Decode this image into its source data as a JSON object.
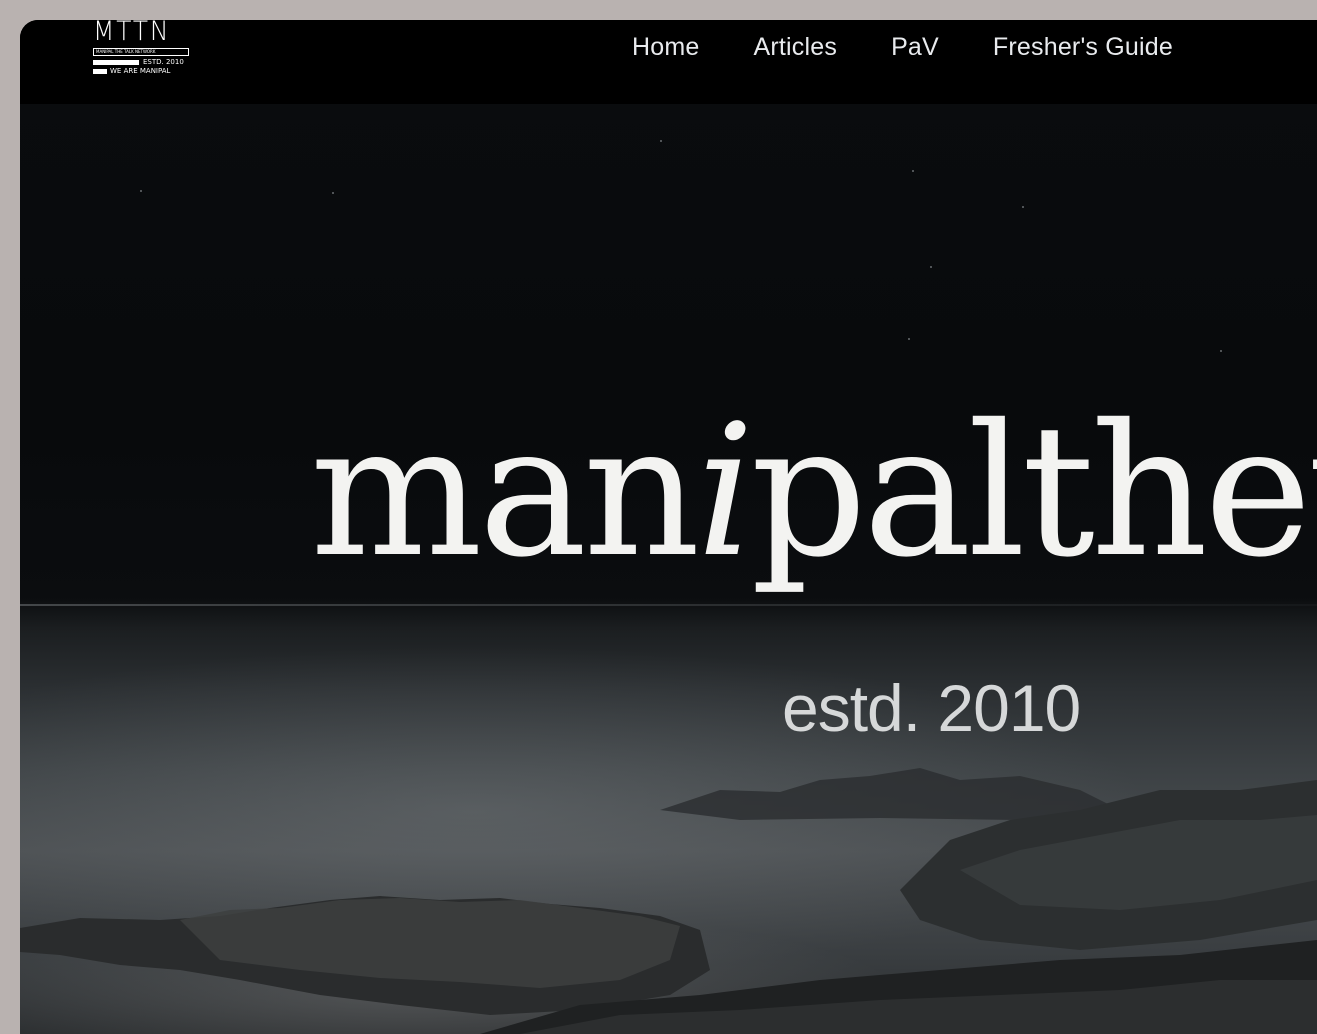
{
  "brand": {
    "logo_mark": "MTTN",
    "logo_line1": "MANIPAL THE TALK NETWORK",
    "logo_line2": "ESTD. 2010",
    "logo_line3": "WE ARE MANIPAL"
  },
  "nav": {
    "items": [
      {
        "label": "Home"
      },
      {
        "label": "Articles"
      },
      {
        "label": "PaV"
      },
      {
        "label": "Fresher's Guide"
      }
    ]
  },
  "hero": {
    "wordmark_pre": "man",
    "wordmark_italic": "i",
    "wordmark_post": "paltheta",
    "tagline": "estd. 2010"
  },
  "colors": {
    "nav_bg": "#000000",
    "text": "#f3f3f1",
    "frame_bg": "#b9b2b0"
  }
}
